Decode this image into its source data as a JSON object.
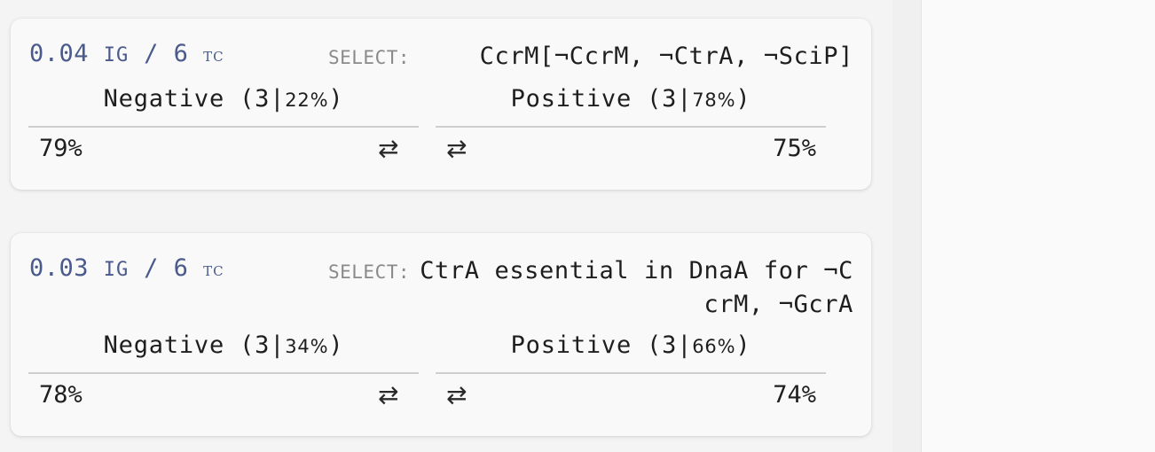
{
  "cards": [
    {
      "score_value": "0.04",
      "score_ig": "IG",
      "score_sep": "/",
      "score_count": "6",
      "score_tc": "TC",
      "select_label": "SELECT:",
      "select_text": "CcrM[¬CcrM, ¬CtrA, ¬SciP]",
      "negative": {
        "label": "Negative (3|",
        "percent_small": "22%",
        "close": ")",
        "value": "79%",
        "swap_icon": "⇄"
      },
      "positive": {
        "label": "Positive (3|",
        "percent_small": "78%",
        "close": ")",
        "value": "75%",
        "swap_icon": "⇄"
      }
    },
    {
      "score_value": "0.03",
      "score_ig": "IG",
      "score_sep": "/",
      "score_count": "6",
      "score_tc": "TC",
      "select_label": "SELECT:",
      "select_text": "CtrA essential in DnaA for ¬CcrM, ¬GcrA",
      "negative": {
        "label": "Negative (3|",
        "percent_small": "34%",
        "close": ")",
        "value": "78%",
        "swap_icon": "⇄"
      },
      "positive": {
        "label": "Positive (3|",
        "percent_small": "66%",
        "close": ")",
        "value": "74%",
        "swap_icon": "⇄"
      }
    }
  ],
  "colors": {
    "score": "#4a5a8c",
    "select_label": "#8a8a8a",
    "text": "#1e1e1e",
    "rule": "#cfcfcf",
    "card_bg": "#f9f9f9",
    "page_bg": "#f4f4f4"
  },
  "icons": {
    "swap": "swap-arrows-icon"
  }
}
